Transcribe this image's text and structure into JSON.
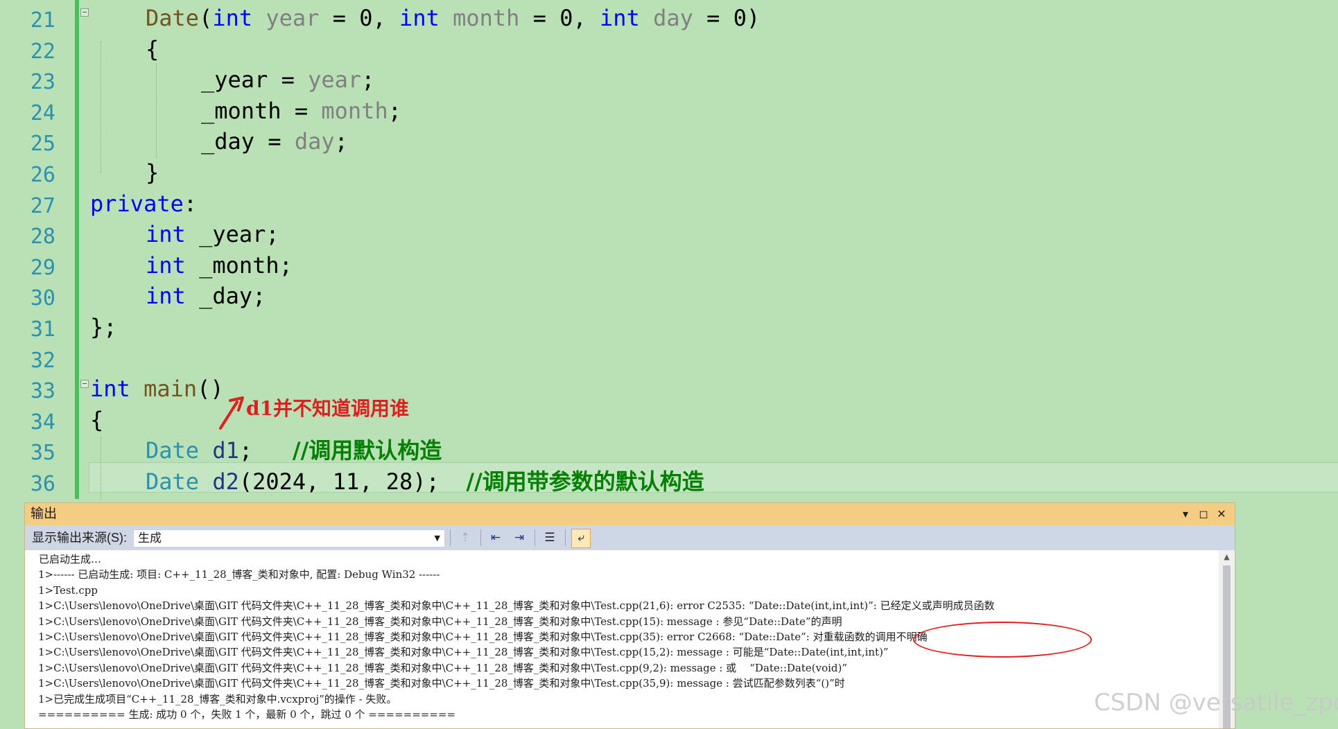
{
  "editor": {
    "lines": [
      {
        "num": "21",
        "tokens": [
          [
            "fn",
            "Date"
          ],
          [
            "pu",
            "("
          ],
          [
            "kw",
            "int"
          ],
          [
            "pu",
            " "
          ],
          [
            "par",
            "year"
          ],
          [
            "pu",
            " = 0, "
          ],
          [
            "kw",
            "int"
          ],
          [
            "pu",
            " "
          ],
          [
            "par",
            "month"
          ],
          [
            "pu",
            " = 0, "
          ],
          [
            "kw",
            "int"
          ],
          [
            "pu",
            " "
          ],
          [
            "par",
            "day"
          ],
          [
            "pu",
            " = 0)"
          ]
        ]
      },
      {
        "num": "22",
        "tokens": [
          [
            "pu",
            "{"
          ]
        ]
      },
      {
        "num": "23",
        "tokens": [
          [
            "mem",
            "_year"
          ],
          [
            "pu",
            " = "
          ],
          [
            "par",
            "year"
          ],
          [
            "pu",
            ";"
          ]
        ]
      },
      {
        "num": "24",
        "tokens": [
          [
            "mem",
            "_month"
          ],
          [
            "pu",
            " = "
          ],
          [
            "par",
            "month"
          ],
          [
            "pu",
            ";"
          ]
        ]
      },
      {
        "num": "25",
        "tokens": [
          [
            "mem",
            "_day"
          ],
          [
            "pu",
            " = "
          ],
          [
            "par",
            "day"
          ],
          [
            "pu",
            ";"
          ]
        ]
      },
      {
        "num": "26",
        "tokens": [
          [
            "pu",
            "}"
          ]
        ]
      },
      {
        "num": "27",
        "tokens": [
          [
            "kw",
            "private"
          ],
          [
            "pu",
            ":"
          ]
        ]
      },
      {
        "num": "28",
        "tokens": [
          [
            "kw",
            "int"
          ],
          [
            "pu",
            " _year;"
          ]
        ]
      },
      {
        "num": "29",
        "tokens": [
          [
            "kw",
            "int"
          ],
          [
            "pu",
            " _month;"
          ]
        ]
      },
      {
        "num": "30",
        "tokens": [
          [
            "kw",
            "int"
          ],
          [
            "pu",
            " _day;"
          ]
        ]
      },
      {
        "num": "31",
        "tokens": [
          [
            "pu",
            "};"
          ]
        ]
      },
      {
        "num": "32",
        "tokens": []
      },
      {
        "num": "33",
        "tokens": [
          [
            "kw",
            "int"
          ],
          [
            "pu",
            " "
          ],
          [
            "fn",
            "main"
          ],
          [
            "pu",
            "()"
          ]
        ]
      },
      {
        "num": "34",
        "tokens": [
          [
            "pu",
            "{"
          ]
        ]
      },
      {
        "num": "35",
        "tokens": [
          [
            "ty",
            "Date"
          ],
          [
            "pu",
            " "
          ],
          [
            "var",
            "d1"
          ],
          [
            "pu",
            ";   "
          ],
          [
            "cm",
            "//调用默认构造"
          ]
        ]
      },
      {
        "num": "36",
        "tokens": [
          [
            "ty",
            "Date"
          ],
          [
            "pu",
            " "
          ],
          [
            "var",
            "d2"
          ],
          [
            "pu",
            "(2024, 11, 28);  "
          ],
          [
            "cm",
            "//调用带参数的默认构造"
          ]
        ]
      }
    ]
  },
  "annotation": {
    "text": "d1并不知道调用谁",
    "color": "#e01e1e"
  },
  "output": {
    "title": "输出",
    "source_label": "显示输出来源(S):",
    "source_value": "生成",
    "lines": [
      "已启动生成…",
      "1>------ 已启动生成: 项目: C++_11_28_博客_类和对象中, 配置: Debug Win32 ------",
      "1>Test.cpp",
      "1>C:\\Users\\lenovo\\OneDrive\\桌面\\GIT 代码文件夹\\C++_11_28_博客_类和对象中\\C++_11_28_博客_类和对象中\\Test.cpp(21,6): error C2535: “Date::Date(int,int,int)”: 已经定义或声明成员函数",
      "1>C:\\Users\\lenovo\\OneDrive\\桌面\\GIT 代码文件夹\\C++_11_28_博客_类和对象中\\C++_11_28_博客_类和对象中\\Test.cpp(15): message : 参见“Date::Date”的声明",
      "1>C:\\Users\\lenovo\\OneDrive\\桌面\\GIT 代码文件夹\\C++_11_28_博客_类和对象中\\C++_11_28_博客_类和对象中\\Test.cpp(35): error C2668: “Date::Date”: 对重载函数的调用不明确",
      "1>C:\\Users\\lenovo\\OneDrive\\桌面\\GIT 代码文件夹\\C++_11_28_博客_类和对象中\\C++_11_28_博客_类和对象中\\Test.cpp(15,2): message : 可能是“Date::Date(int,int,int)”",
      "1>C:\\Users\\lenovo\\OneDrive\\桌面\\GIT 代码文件夹\\C++_11_28_博客_类和对象中\\C++_11_28_博客_类和对象中\\Test.cpp(9,2): message : 或    “Date::Date(void)”",
      "1>C:\\Users\\lenovo\\OneDrive\\桌面\\GIT 代码文件夹\\C++_11_28_博客_类和对象中\\C++_11_28_博客_类和对象中\\Test.cpp(35,9): message : 尝试匹配参数列表“()”时",
      "1>已完成生成项目“C++_11_28_博客_类和对象中.vcxproj”的操作 - 失败。",
      "========== 生成: 成功 0 个，失败 1 个，最新 0 个，跳过 0 个 =========="
    ]
  },
  "watermark": "CSDN @versatile_zpc",
  "colors": {
    "editor_bg": "#bae1b6",
    "panel_title": "#f5cc84",
    "toolbar": "#cfd6e5",
    "highlight_circle": "#e01e1e"
  }
}
